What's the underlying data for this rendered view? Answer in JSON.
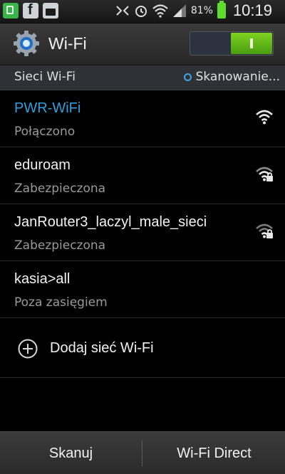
{
  "status_bar": {
    "battery_percent": "81%",
    "time": "10:19",
    "battery_color": "#5fdc2b"
  },
  "title_bar": {
    "title": "Wi-Fi",
    "toggle_on": true,
    "toggle_color": "#7ed321"
  },
  "section": {
    "title": "Sieci Wi-Fi",
    "scan_status": "Skanowanie..."
  },
  "networks": [
    {
      "name": "PWR-WiFi",
      "status": "Połączono",
      "connected": true,
      "secured": false,
      "signal_bars": 4
    },
    {
      "name": "eduroam",
      "status": "Zabezpieczona",
      "connected": false,
      "secured": true,
      "signal_bars": 3
    },
    {
      "name": "JanRouter3_laczyl_male_sieci",
      "status": "Zabezpieczona",
      "connected": false,
      "secured": true,
      "signal_bars": 2
    },
    {
      "name": "kasia>all",
      "status": "Poza zasięgiem",
      "connected": false,
      "secured": false,
      "signal_bars": 0
    }
  ],
  "add_network": {
    "label": "Dodaj sieć Wi-Fi",
    "icon": "plus-circle-icon"
  },
  "bottom_bar": {
    "scan_label": "Skanuj",
    "wifi_direct_label": "Wi-Fi Direct"
  },
  "colors": {
    "accent_blue": "#2f9fde",
    "background": "#000000"
  }
}
